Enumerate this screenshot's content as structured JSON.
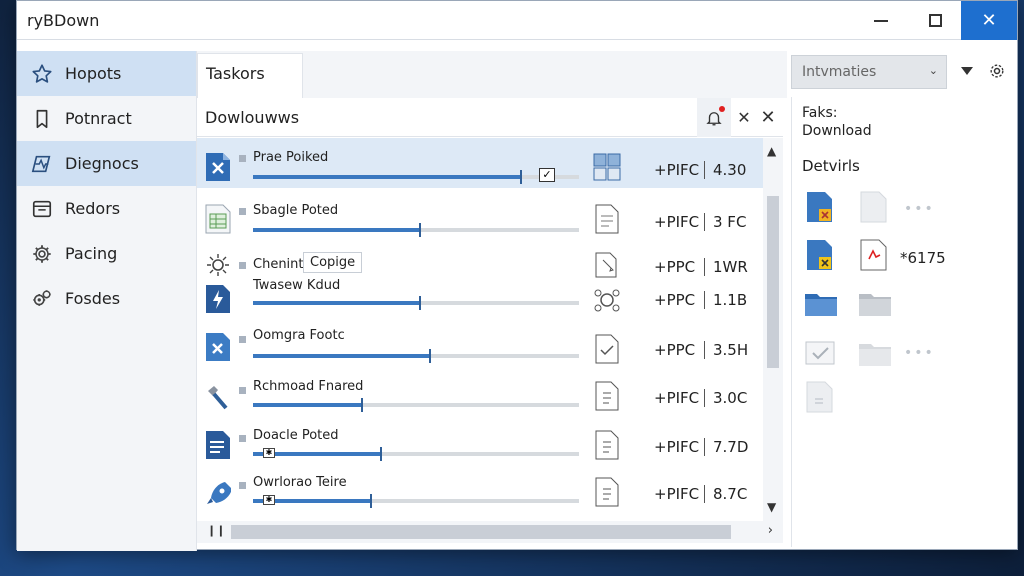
{
  "window": {
    "title": "ryBDown"
  },
  "sidebar": {
    "items": [
      {
        "label": "Hopots",
        "icon": "star-icon",
        "active": true
      },
      {
        "label": "Potnract",
        "icon": "bookmark-icon",
        "active": false
      },
      {
        "label": "Diegnocs",
        "icon": "diagnostics-icon",
        "active": true
      },
      {
        "label": "Redors",
        "icon": "window-icon",
        "active": false
      },
      {
        "label": "Pacing",
        "icon": "gear-icon",
        "active": false
      },
      {
        "label": "Fosdes",
        "icon": "gears-icon",
        "active": false
      }
    ]
  },
  "tabs": [
    {
      "label": "Taskors"
    }
  ],
  "panel": {
    "title": "Dowlouwws"
  },
  "rows": [
    {
      "name": "Prae Poiked",
      "progress": 0.82,
      "prop": "+PIFC",
      "size": "4.30",
      "selected": true,
      "checked": true
    },
    {
      "name": "Sbagle Poted",
      "progress": 0.51,
      "prop": "+PIFC",
      "size": "3 FC"
    },
    {
      "name": "Chenint",
      "copy_label": "Copige",
      "prop": "+PPC",
      "size": "1WR"
    },
    {
      "name": "Twasew Kdud",
      "progress": 0.51,
      "prop": "+PPC",
      "size": "1.1B"
    },
    {
      "name": "Oomgra Footc",
      "progress": 0.54,
      "prop": "+PPC",
      "size": "3.5H"
    },
    {
      "name": "Rchmoad Fnared",
      "progress": 0.33,
      "prop": "+PIFC",
      "size": "3.0C"
    },
    {
      "name": "Doacle Poted",
      "progress": 0.39,
      "prop": "+PIFC",
      "size": "7.7D"
    },
    {
      "name": "Owrlorao Teire",
      "progress": 0.36,
      "prop": "+PIFC",
      "size": "8.7C"
    }
  ],
  "right": {
    "combo_value": "Intvmaties",
    "line1": "Faks:",
    "line2": "Download",
    "details_heading": "Detvirls",
    "detail_value": "*6175"
  },
  "colors": {
    "accent": "#1e6fcf",
    "progress": "#3a78c0",
    "selected_row": "#dde9f6"
  }
}
